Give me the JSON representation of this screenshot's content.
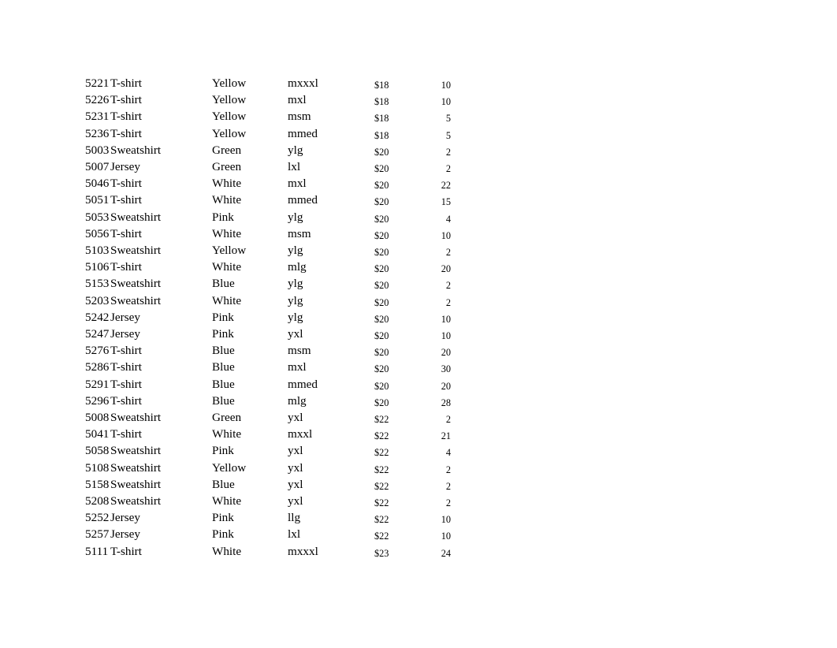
{
  "document": {
    "kind": "inventory-listing",
    "background_color": "#ffffff",
    "text_color": "#000000",
    "row_count": 29,
    "columns": [
      "id",
      "product",
      "color",
      "size",
      "price",
      "quantity"
    ]
  },
  "rows": [
    {
      "id": "5221",
      "product": "T-shirt",
      "color": "Yellow",
      "size": "mxxxl",
      "price": "$18",
      "quantity": "10"
    },
    {
      "id": "5226",
      "product": "T-shirt",
      "color": "Yellow",
      "size": "mxl",
      "price": "$18",
      "quantity": "10"
    },
    {
      "id": "5231",
      "product": "T-shirt",
      "color": "Yellow",
      "size": "msm",
      "price": "$18",
      "quantity": "5"
    },
    {
      "id": "5236",
      "product": "T-shirt",
      "color": "Yellow",
      "size": "mmed",
      "price": "$18",
      "quantity": "5"
    },
    {
      "id": "5003",
      "product": "Sweatshirt",
      "color": "Green",
      "size": "ylg",
      "price": "$20",
      "quantity": "2"
    },
    {
      "id": "5007",
      "product": "Jersey",
      "color": "Green",
      "size": "lxl",
      "price": "$20",
      "quantity": "2"
    },
    {
      "id": "5046",
      "product": "T-shirt",
      "color": "White",
      "size": "mxl",
      "price": "$20",
      "quantity": "22"
    },
    {
      "id": "5051",
      "product": "T-shirt",
      "color": "White",
      "size": "mmed",
      "price": "$20",
      "quantity": "15"
    },
    {
      "id": "5053",
      "product": "Sweatshirt",
      "color": "Pink",
      "size": "ylg",
      "price": "$20",
      "quantity": "4"
    },
    {
      "id": "5056",
      "product": "T-shirt",
      "color": "White",
      "size": "msm",
      "price": "$20",
      "quantity": "10"
    },
    {
      "id": "5103",
      "product": "Sweatshirt",
      "color": "Yellow",
      "size": "ylg",
      "price": "$20",
      "quantity": "2"
    },
    {
      "id": "5106",
      "product": "T-shirt",
      "color": "White",
      "size": "mlg",
      "price": "$20",
      "quantity": "20"
    },
    {
      "id": "5153",
      "product": "Sweatshirt",
      "color": "Blue",
      "size": "ylg",
      "price": "$20",
      "quantity": "2"
    },
    {
      "id": "5203",
      "product": "Sweatshirt",
      "color": "White",
      "size": "ylg",
      "price": "$20",
      "quantity": "2"
    },
    {
      "id": "5242",
      "product": "Jersey",
      "color": "Pink",
      "size": "ylg",
      "price": "$20",
      "quantity": "10"
    },
    {
      "id": "5247",
      "product": "Jersey",
      "color": "Pink",
      "size": "yxl",
      "price": "$20",
      "quantity": "10"
    },
    {
      "id": "5276",
      "product": "T-shirt",
      "color": "Blue",
      "size": "msm",
      "price": "$20",
      "quantity": "20"
    },
    {
      "id": "5286",
      "product": "T-shirt",
      "color": "Blue",
      "size": "mxl",
      "price": "$20",
      "quantity": "30"
    },
    {
      "id": "5291",
      "product": "T-shirt",
      "color": "Blue",
      "size": "mmed",
      "price": "$20",
      "quantity": "20"
    },
    {
      "id": "5296",
      "product": "T-shirt",
      "color": "Blue",
      "size": "mlg",
      "price": "$20",
      "quantity": "28"
    },
    {
      "id": "5008",
      "product": "Sweatshirt",
      "color": "Green",
      "size": "yxl",
      "price": "$22",
      "quantity": "2"
    },
    {
      "id": "5041",
      "product": "T-shirt",
      "color": "White",
      "size": "mxxl",
      "price": "$22",
      "quantity": "21"
    },
    {
      "id": "5058",
      "product": "Sweatshirt",
      "color": "Pink",
      "size": "yxl",
      "price": "$22",
      "quantity": "4"
    },
    {
      "id": "5108",
      "product": "Sweatshirt",
      "color": "Yellow",
      "size": "yxl",
      "price": "$22",
      "quantity": "2"
    },
    {
      "id": "5158",
      "product": "Sweatshirt",
      "color": "Blue",
      "size": "yxl",
      "price": "$22",
      "quantity": "2"
    },
    {
      "id": "5208",
      "product": "Sweatshirt",
      "color": "White",
      "size": "yxl",
      "price": "$22",
      "quantity": "2"
    },
    {
      "id": "5252",
      "product": "Jersey",
      "color": "Pink",
      "size": "llg",
      "price": "$22",
      "quantity": "10"
    },
    {
      "id": "5257",
      "product": "Jersey",
      "color": "Pink",
      "size": "lxl",
      "price": "$22",
      "quantity": "10"
    },
    {
      "id": "5111",
      "product": "T-shirt",
      "color": "White",
      "size": "mxxxl",
      "price": "$23",
      "quantity": "24"
    }
  ]
}
